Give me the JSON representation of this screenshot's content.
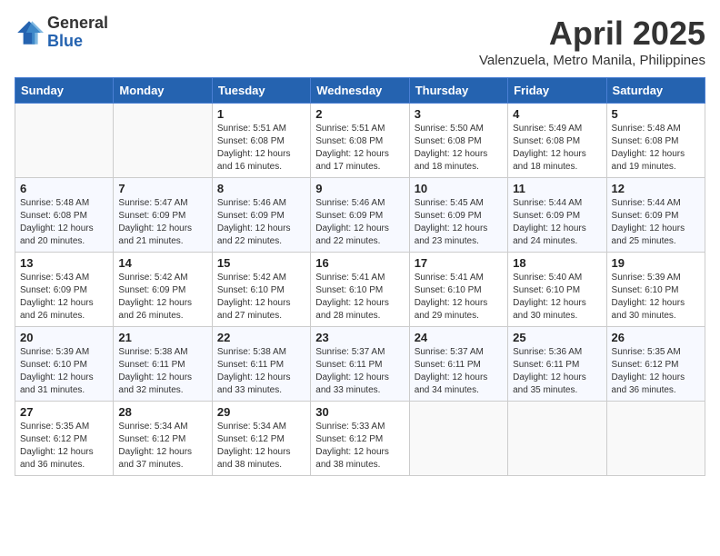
{
  "logo": {
    "general": "General",
    "blue": "Blue"
  },
  "title": "April 2025",
  "subtitle": "Valenzuela, Metro Manila, Philippines",
  "headers": [
    "Sunday",
    "Monday",
    "Tuesday",
    "Wednesday",
    "Thursday",
    "Friday",
    "Saturday"
  ],
  "weeks": [
    [
      {
        "day": "",
        "info": ""
      },
      {
        "day": "",
        "info": ""
      },
      {
        "day": "1",
        "info": "Sunrise: 5:51 AM\nSunset: 6:08 PM\nDaylight: 12 hours and 16 minutes."
      },
      {
        "day": "2",
        "info": "Sunrise: 5:51 AM\nSunset: 6:08 PM\nDaylight: 12 hours and 17 minutes."
      },
      {
        "day": "3",
        "info": "Sunrise: 5:50 AM\nSunset: 6:08 PM\nDaylight: 12 hours and 18 minutes."
      },
      {
        "day": "4",
        "info": "Sunrise: 5:49 AM\nSunset: 6:08 PM\nDaylight: 12 hours and 18 minutes."
      },
      {
        "day": "5",
        "info": "Sunrise: 5:48 AM\nSunset: 6:08 PM\nDaylight: 12 hours and 19 minutes."
      }
    ],
    [
      {
        "day": "6",
        "info": "Sunrise: 5:48 AM\nSunset: 6:08 PM\nDaylight: 12 hours and 20 minutes."
      },
      {
        "day": "7",
        "info": "Sunrise: 5:47 AM\nSunset: 6:09 PM\nDaylight: 12 hours and 21 minutes."
      },
      {
        "day": "8",
        "info": "Sunrise: 5:46 AM\nSunset: 6:09 PM\nDaylight: 12 hours and 22 minutes."
      },
      {
        "day": "9",
        "info": "Sunrise: 5:46 AM\nSunset: 6:09 PM\nDaylight: 12 hours and 22 minutes."
      },
      {
        "day": "10",
        "info": "Sunrise: 5:45 AM\nSunset: 6:09 PM\nDaylight: 12 hours and 23 minutes."
      },
      {
        "day": "11",
        "info": "Sunrise: 5:44 AM\nSunset: 6:09 PM\nDaylight: 12 hours and 24 minutes."
      },
      {
        "day": "12",
        "info": "Sunrise: 5:44 AM\nSunset: 6:09 PM\nDaylight: 12 hours and 25 minutes."
      }
    ],
    [
      {
        "day": "13",
        "info": "Sunrise: 5:43 AM\nSunset: 6:09 PM\nDaylight: 12 hours and 26 minutes."
      },
      {
        "day": "14",
        "info": "Sunrise: 5:42 AM\nSunset: 6:09 PM\nDaylight: 12 hours and 26 minutes."
      },
      {
        "day": "15",
        "info": "Sunrise: 5:42 AM\nSunset: 6:10 PM\nDaylight: 12 hours and 27 minutes."
      },
      {
        "day": "16",
        "info": "Sunrise: 5:41 AM\nSunset: 6:10 PM\nDaylight: 12 hours and 28 minutes."
      },
      {
        "day": "17",
        "info": "Sunrise: 5:41 AM\nSunset: 6:10 PM\nDaylight: 12 hours and 29 minutes."
      },
      {
        "day": "18",
        "info": "Sunrise: 5:40 AM\nSunset: 6:10 PM\nDaylight: 12 hours and 30 minutes."
      },
      {
        "day": "19",
        "info": "Sunrise: 5:39 AM\nSunset: 6:10 PM\nDaylight: 12 hours and 30 minutes."
      }
    ],
    [
      {
        "day": "20",
        "info": "Sunrise: 5:39 AM\nSunset: 6:10 PM\nDaylight: 12 hours and 31 minutes."
      },
      {
        "day": "21",
        "info": "Sunrise: 5:38 AM\nSunset: 6:11 PM\nDaylight: 12 hours and 32 minutes."
      },
      {
        "day": "22",
        "info": "Sunrise: 5:38 AM\nSunset: 6:11 PM\nDaylight: 12 hours and 33 minutes."
      },
      {
        "day": "23",
        "info": "Sunrise: 5:37 AM\nSunset: 6:11 PM\nDaylight: 12 hours and 33 minutes."
      },
      {
        "day": "24",
        "info": "Sunrise: 5:37 AM\nSunset: 6:11 PM\nDaylight: 12 hours and 34 minutes."
      },
      {
        "day": "25",
        "info": "Sunrise: 5:36 AM\nSunset: 6:11 PM\nDaylight: 12 hours and 35 minutes."
      },
      {
        "day": "26",
        "info": "Sunrise: 5:35 AM\nSunset: 6:12 PM\nDaylight: 12 hours and 36 minutes."
      }
    ],
    [
      {
        "day": "27",
        "info": "Sunrise: 5:35 AM\nSunset: 6:12 PM\nDaylight: 12 hours and 36 minutes."
      },
      {
        "day": "28",
        "info": "Sunrise: 5:34 AM\nSunset: 6:12 PM\nDaylight: 12 hours and 37 minutes."
      },
      {
        "day": "29",
        "info": "Sunrise: 5:34 AM\nSunset: 6:12 PM\nDaylight: 12 hours and 38 minutes."
      },
      {
        "day": "30",
        "info": "Sunrise: 5:33 AM\nSunset: 6:12 PM\nDaylight: 12 hours and 38 minutes."
      },
      {
        "day": "",
        "info": ""
      },
      {
        "day": "",
        "info": ""
      },
      {
        "day": "",
        "info": ""
      }
    ]
  ]
}
